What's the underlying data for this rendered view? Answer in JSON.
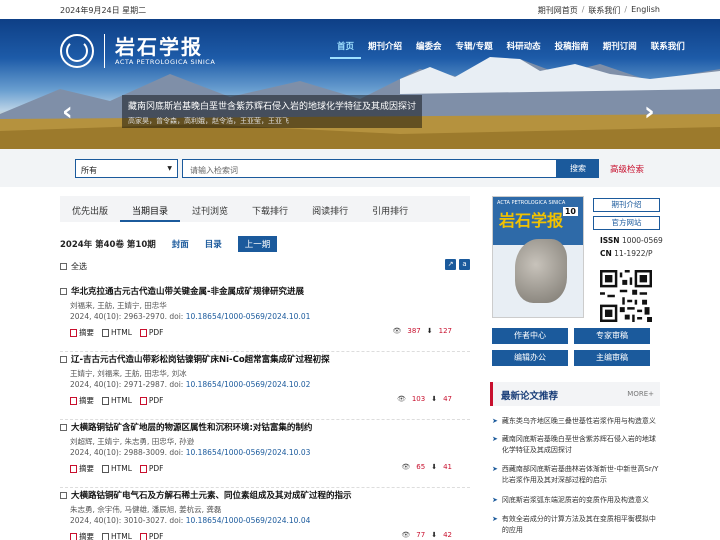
{
  "topbar": {
    "date": "2024年9月24日 星期二",
    "link1": "期刊网首页",
    "link2": "联系我们",
    "link3": "English",
    "sep": "/"
  },
  "logo": {
    "cn": "岩石学报",
    "en": "ACTA PETROLOGICA SINICA"
  },
  "nav": [
    "首页",
    "期刊介绍",
    "编委会",
    "专辑/专题",
    "科研动态",
    "投稿指南",
    "期刊订阅",
    "联系我们"
  ],
  "banner": {
    "title": "藏南冈底斯岩基晚白垩世含紫苏辉石侵入岩的地球化学特征及其成因探讨",
    "authors": "高家昊，曾令森，高利娥，赵令浩，王亚莹，王亚飞",
    "left_arrow": "‹",
    "right_arrow": "›"
  },
  "search": {
    "select": "所有",
    "placeholder": "请输入检索词",
    "button": "搜索",
    "advanced": "高级检索"
  },
  "tabs": [
    "优先出版",
    "当期目录",
    "过刊浏览",
    "下载排行",
    "阅读排行",
    "引用排行"
  ],
  "issue": {
    "label": "2024年 第40卷 第10期",
    "cover": "封面",
    "toc": "目录",
    "prev": "上一期"
  },
  "select_all": "全选",
  "articles": [
    {
      "title": "华北克拉通古元古代造山带关键金属-非金属成矿规律研究进展",
      "authors": "刘福来,  王舫,  王婧宁,  田忠华",
      "cite": "2024, 40(10): 2963-2970.  doi: ",
      "doi": "10.18654/1000-0569/2024.10.01",
      "views": "387",
      "downloads": "127"
    },
    {
      "title": "辽-吉古元古代造山带彩松岗钴镍铜矿床Ni-Co超常富集成矿过程初探",
      "authors": "王婧宁,  刘福来,  王舫,  田忠华,  刘冰",
      "cite": "2024, 40(10): 2971-2987.  doi: ",
      "doi": "10.18654/1000-0569/2024.10.02",
      "views": "103",
      "downloads": "47"
    },
    {
      "title": "大横路铜钴矿含矿地层的物源区属性和沉积环境:对钴富集的制约",
      "authors": "刘超辉,  王婧宁,  朱志勇,  田忠华,  孙逊",
      "cite": "2024, 40(10): 2988-3009.  doi: ",
      "doi": "10.18654/1000-0569/2024.10.03",
      "views": "65",
      "downloads": "41"
    },
    {
      "title": "大横路钴铜矿电气石及方解石稀土元素、同位素组成及其对成矿过程的指示",
      "authors": "朱志勇,  佘宇伟,  马健雄,  潘辰旭,  姜杭云,  龚磊",
      "cite": "2024, 40(10): 3010-3027.  doi: ",
      "doi": "10.18654/1000-0569/2024.10.04",
      "views": "77",
      "downloads": "42"
    }
  ],
  "art_actions": {
    "abstract": "摘要",
    "html": "HTML",
    "pdf": "PDF"
  },
  "cover": {
    "en": "ACTA PETROLOGICA SINICA",
    "cn": "岩石学报",
    "num": "10"
  },
  "side": {
    "intro": "期刊介绍",
    "site": "官方网站",
    "issn": "ISSN 1000-0569",
    "cn": "CN 11-1922/P",
    "issn_label": "ISSN",
    "issn_val": "1000-0569",
    "cn_label": "CN",
    "cn_val": "11-1922/P",
    "b1": "作者中心",
    "b2": "专家审稿",
    "b3": "编辑办公",
    "b4": "主编审稿"
  },
  "latest": {
    "title": "最新论文推荐",
    "more": "MORE+",
    "items": [
      "藏东类乌齐地区晚三叠世基性岩浆作用与构造意义",
      "藏南冈底斯岩基晚白垩世含紫苏辉石侵入岩的地球化学特征及其成因探讨",
      "西藏南部冈底斯岩基曲林岩体渐新世-中新世高Sr/Y比岩浆作用及其对深部过程的启示",
      "冈底斯岩浆弧东端泥质岩的变质作用及构造意义",
      "有效全岩成分的计算方法及其在变质相平衡模拟中的应用"
    ]
  }
}
